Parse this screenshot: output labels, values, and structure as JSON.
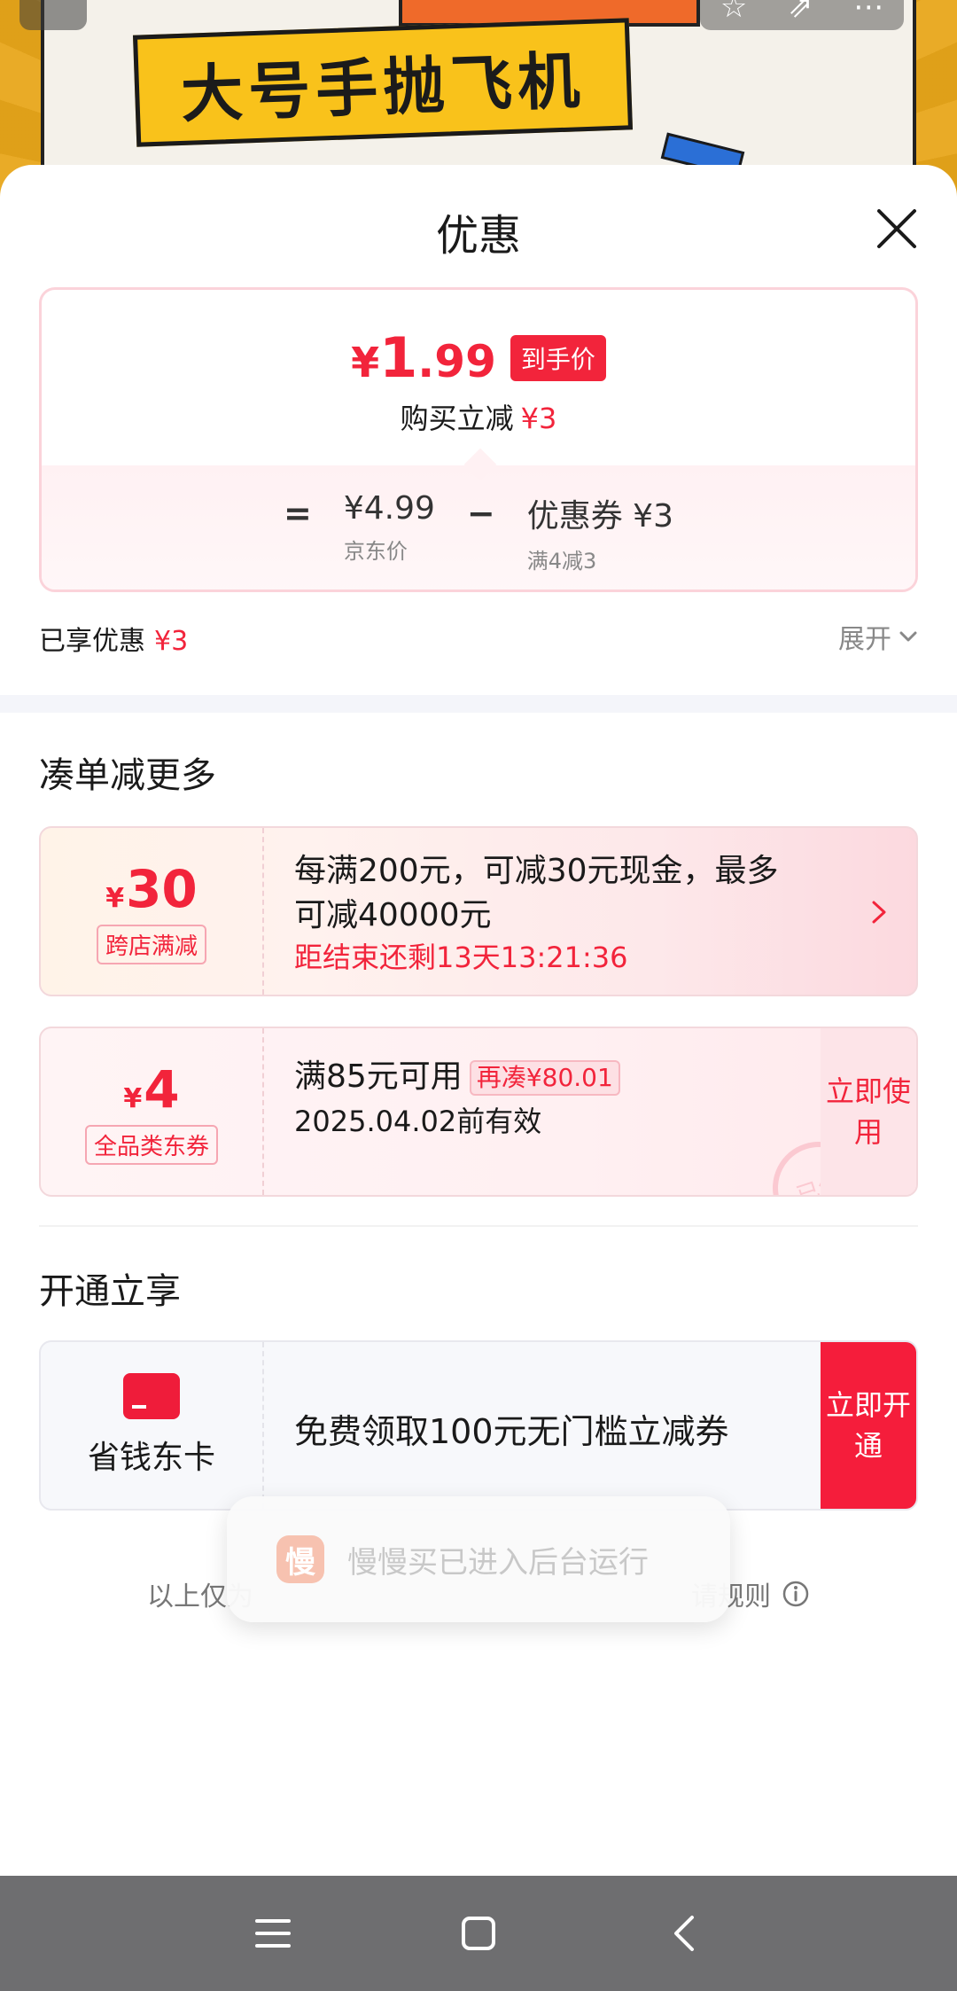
{
  "banner": {
    "title": "大号手抛飞机"
  },
  "sheet": {
    "title": "优惠"
  },
  "price_card": {
    "currency": "¥",
    "final_int": "1",
    "final_dec": ".99",
    "final_tag": "到手价",
    "reduce_label": "购买立减",
    "reduce_value": "¥3",
    "equals": "=",
    "minus": "−",
    "jd_price": "¥4.99",
    "jd_price_label": "京东价",
    "coupon_value": "优惠券 ¥3",
    "coupon_rule": "满4减3"
  },
  "enjoyed": {
    "label": "已享优惠",
    "value": "¥3"
  },
  "expand_label": "展开",
  "more_section": {
    "title": "凑单减更多"
  },
  "coupons": [
    {
      "currency": "¥",
      "amount": "30",
      "label": "跨店满减",
      "line1": "每满200元，可减30元现金，最多",
      "line2": "可减40000元",
      "countdown": "距结束还剩13天13:21:36"
    },
    {
      "currency": "¥",
      "amount": "4",
      "label": "全品类东券",
      "condition": "满85元可用",
      "rebate": "再凑¥80.01",
      "validity": "2025.04.02前有效",
      "action": "立即使用",
      "stamp": "已领"
    }
  ],
  "membership_section": {
    "title": "开通立享"
  },
  "membership": {
    "card_name": "省钱东卡",
    "text": "免费领取100元无门槛立减券",
    "action": "立即开通"
  },
  "disclaimer": {
    "prefix": "以上仅为",
    "suffix": "请规则"
  },
  "toast": {
    "icon_text": "慢",
    "message": "慢慢买已进入后台运行"
  },
  "colors": {
    "accent": "#f2243b",
    "navbar": "#6e6e70"
  }
}
